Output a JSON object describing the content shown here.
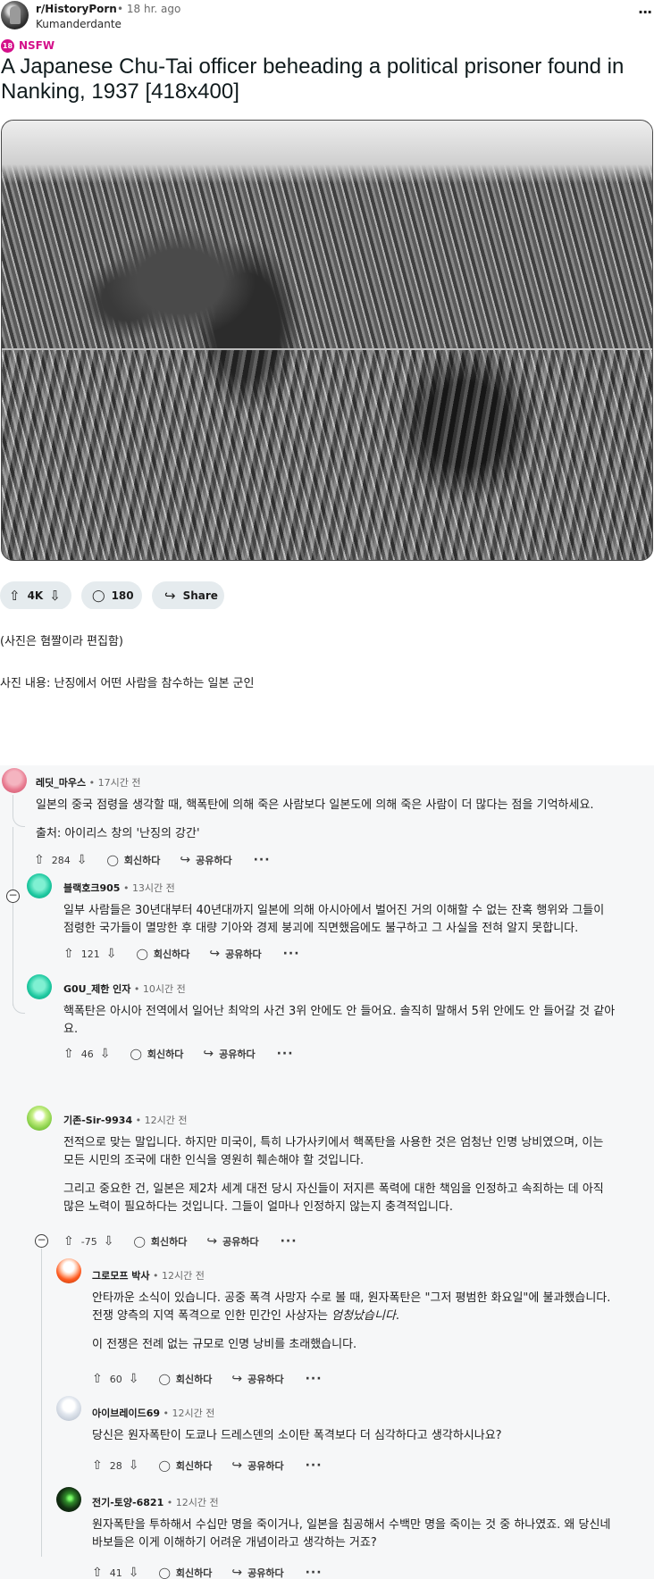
{
  "post": {
    "subreddit": "r/HistoryPorn",
    "age": "18 hr. ago",
    "author": "Kumanderdante",
    "nsfw_badge": "18",
    "nsfw_label": "NSFW",
    "title": "A Japanese Chu-Tai officer beheading a political prisoner found in Nanking, 1937 [418x400]",
    "image_icon": "historical-photo",
    "votes": "4K",
    "comments": "180",
    "share_label": "Share",
    "overflow_icon": "more-horizontal-icon"
  },
  "body": {
    "line1": "(사진은 혐짤이라 편집함)",
    "line2": "사진 내용: 난징에서 어떤 사람을 참수하는 일본 군인"
  },
  "actions": {
    "reply": "회신하다",
    "share": "공유하다",
    "more": "···"
  },
  "comments": [
    {
      "user": "레딧_마우스",
      "age": "17시간 전",
      "text": [
        "일본의 중국 점령을 생각할 때, 핵폭탄에 의해 죽은 사람보다 일본도에 의해 죽은 사람이 더 많다는 점을 기억하세요.",
        "출처: 아이리스 창의 '난징의 강간'"
      ],
      "score": "284",
      "avatar_color": "#e87a90"
    },
    {
      "user": "블랙호크905",
      "age": "13시간 전",
      "text": [
        "일부 사람들은 30년대부터 40년대까지 일본에 의해 아시아에서 벌어진 거의 이해할 수 없는 잔혹 행위와 그들이",
        "점령한 국가들이 멸망한 후 대량 기아와 경제 붕괴에 직면했음에도 불구하고 그 사실을 전혀 알지 못합니다."
      ],
      "score": "121",
      "avatar_color": "#1ec8a0"
    },
    {
      "user": "G0U_제한 인자",
      "age": "10시간 전",
      "text": [
        "핵폭탄은 아시아 전역에서 일어난 최악의 사건 3위 안에도 안 들어요. 솔직히 말해서 5위 안에도 안 들어갈 것 같아",
        "요."
      ],
      "score": "46",
      "avatar_color": "#1ec8a0"
    },
    {
      "user": "기존-Sir-9934",
      "age": "12시간 전",
      "text": [
        "전적으로 맞는 말입니다. 하지만 미국이, 특히 나가사키에서 핵폭탄을 사용한 것은 엄청난 인명 낭비였으며, 이는",
        "모든 시민의 조국에 대한 인식을 영원히 훼손해야 할 것입니다.",
        "그리고 중요한 건, 일본은 제2차 세계 대전 당시 자신들이 저지른 폭력에 대한 책임을 인정하고 속죄하는 데 아직",
        "많은 노력이 필요하다는 것입니다. 그들이 얼마나 인정하지 않는지 충격적입니다."
      ],
      "score": "-75",
      "avatar_color": "#8ad14a"
    },
    {
      "user": "그로모프 박사",
      "age": "12시간 전",
      "text": [
        "안타까운 소식이 있습니다. 공중 폭격 사망자 수로 볼 때, 원자폭탄은 \"그저 평범한 화요일\"에 불과했습니다.",
        "전쟁 양측의 지역 폭격으로 인한 민간인 사상자는",
        "엄청났습니다",
        ".",
        "이 전쟁은 전례 없는 규모로 인명 낭비를 초래했습니다."
      ],
      "score": "60",
      "avatar_color": "#ff5a1f"
    },
    {
      "user": "아이브레이드69",
      "age": "12시간 전",
      "text": [
        "당신은 원자폭탄이 도쿄나 드레스덴의 소이탄 폭격보다 더 심각하다고 생각하시나요?"
      ],
      "score": "28",
      "avatar_color": "#cfd6e0"
    },
    {
      "user": "전기-토양-6821",
      "age": "12시간 전",
      "text": [
        "원자폭탄을 투하해서 수십만 명을 죽이거나, 일본을 침공해서 수백만 명을 죽이는 것 중 하나였죠. 왜 당신네",
        "바보들은 이게 이해하기 어려운 개념이라고 생각하는 거죠?"
      ],
      "score": "41",
      "avatar_color": "#1a3a1a"
    }
  ],
  "icons": {
    "upvote": "⇧",
    "downvote": "⇩",
    "comment": "◯",
    "share": "↪",
    "collapse": "−"
  }
}
